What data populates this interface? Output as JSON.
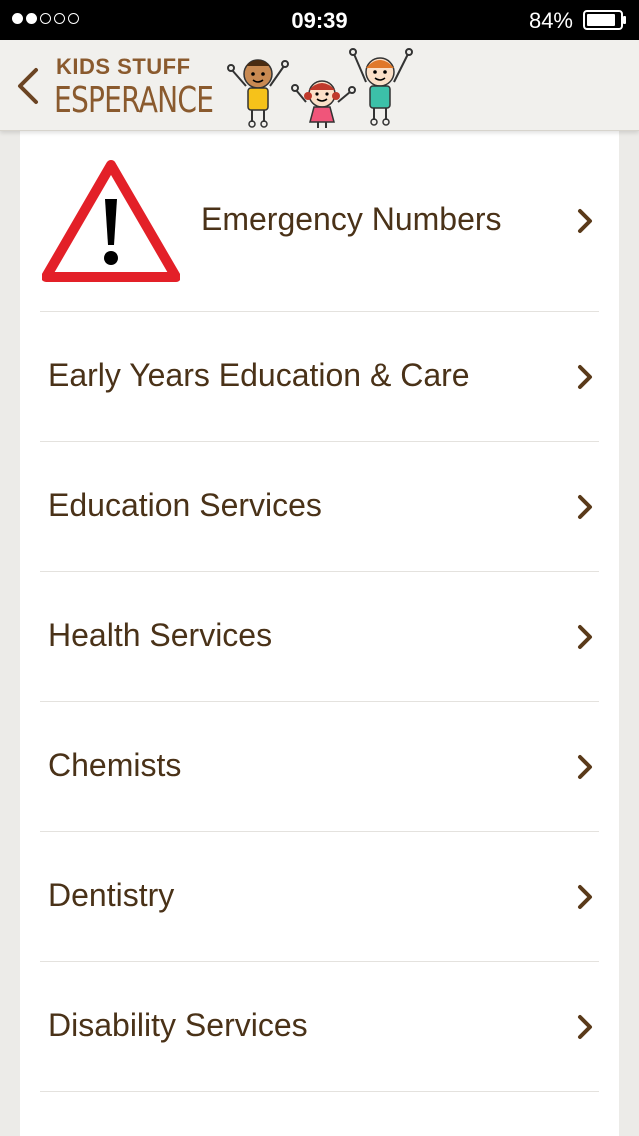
{
  "status_bar": {
    "time": "09:39",
    "battery": "84%",
    "signal_dots_filled": 2,
    "signal_dots_total": 5
  },
  "header": {
    "logo_top": "KIDS STUFF",
    "logo_bottom": "ESPERANCE"
  },
  "menu": {
    "items": [
      {
        "label": "Emergency Numbers"
      },
      {
        "label": "Early Years Education & Care"
      },
      {
        "label": "Education Services"
      },
      {
        "label": "Health Services"
      },
      {
        "label": "Chemists"
      },
      {
        "label": "Dentistry"
      },
      {
        "label": "Disability Services"
      }
    ]
  },
  "colors": {
    "text": "#4a3218",
    "brand": "#8a5a2e",
    "warning_red": "#e32028",
    "chevron": "#5a3a1a"
  },
  "icons": {
    "back": "chevron-left-icon",
    "row": "chevron-right-icon",
    "emergency": "warning-triangle-icon"
  }
}
